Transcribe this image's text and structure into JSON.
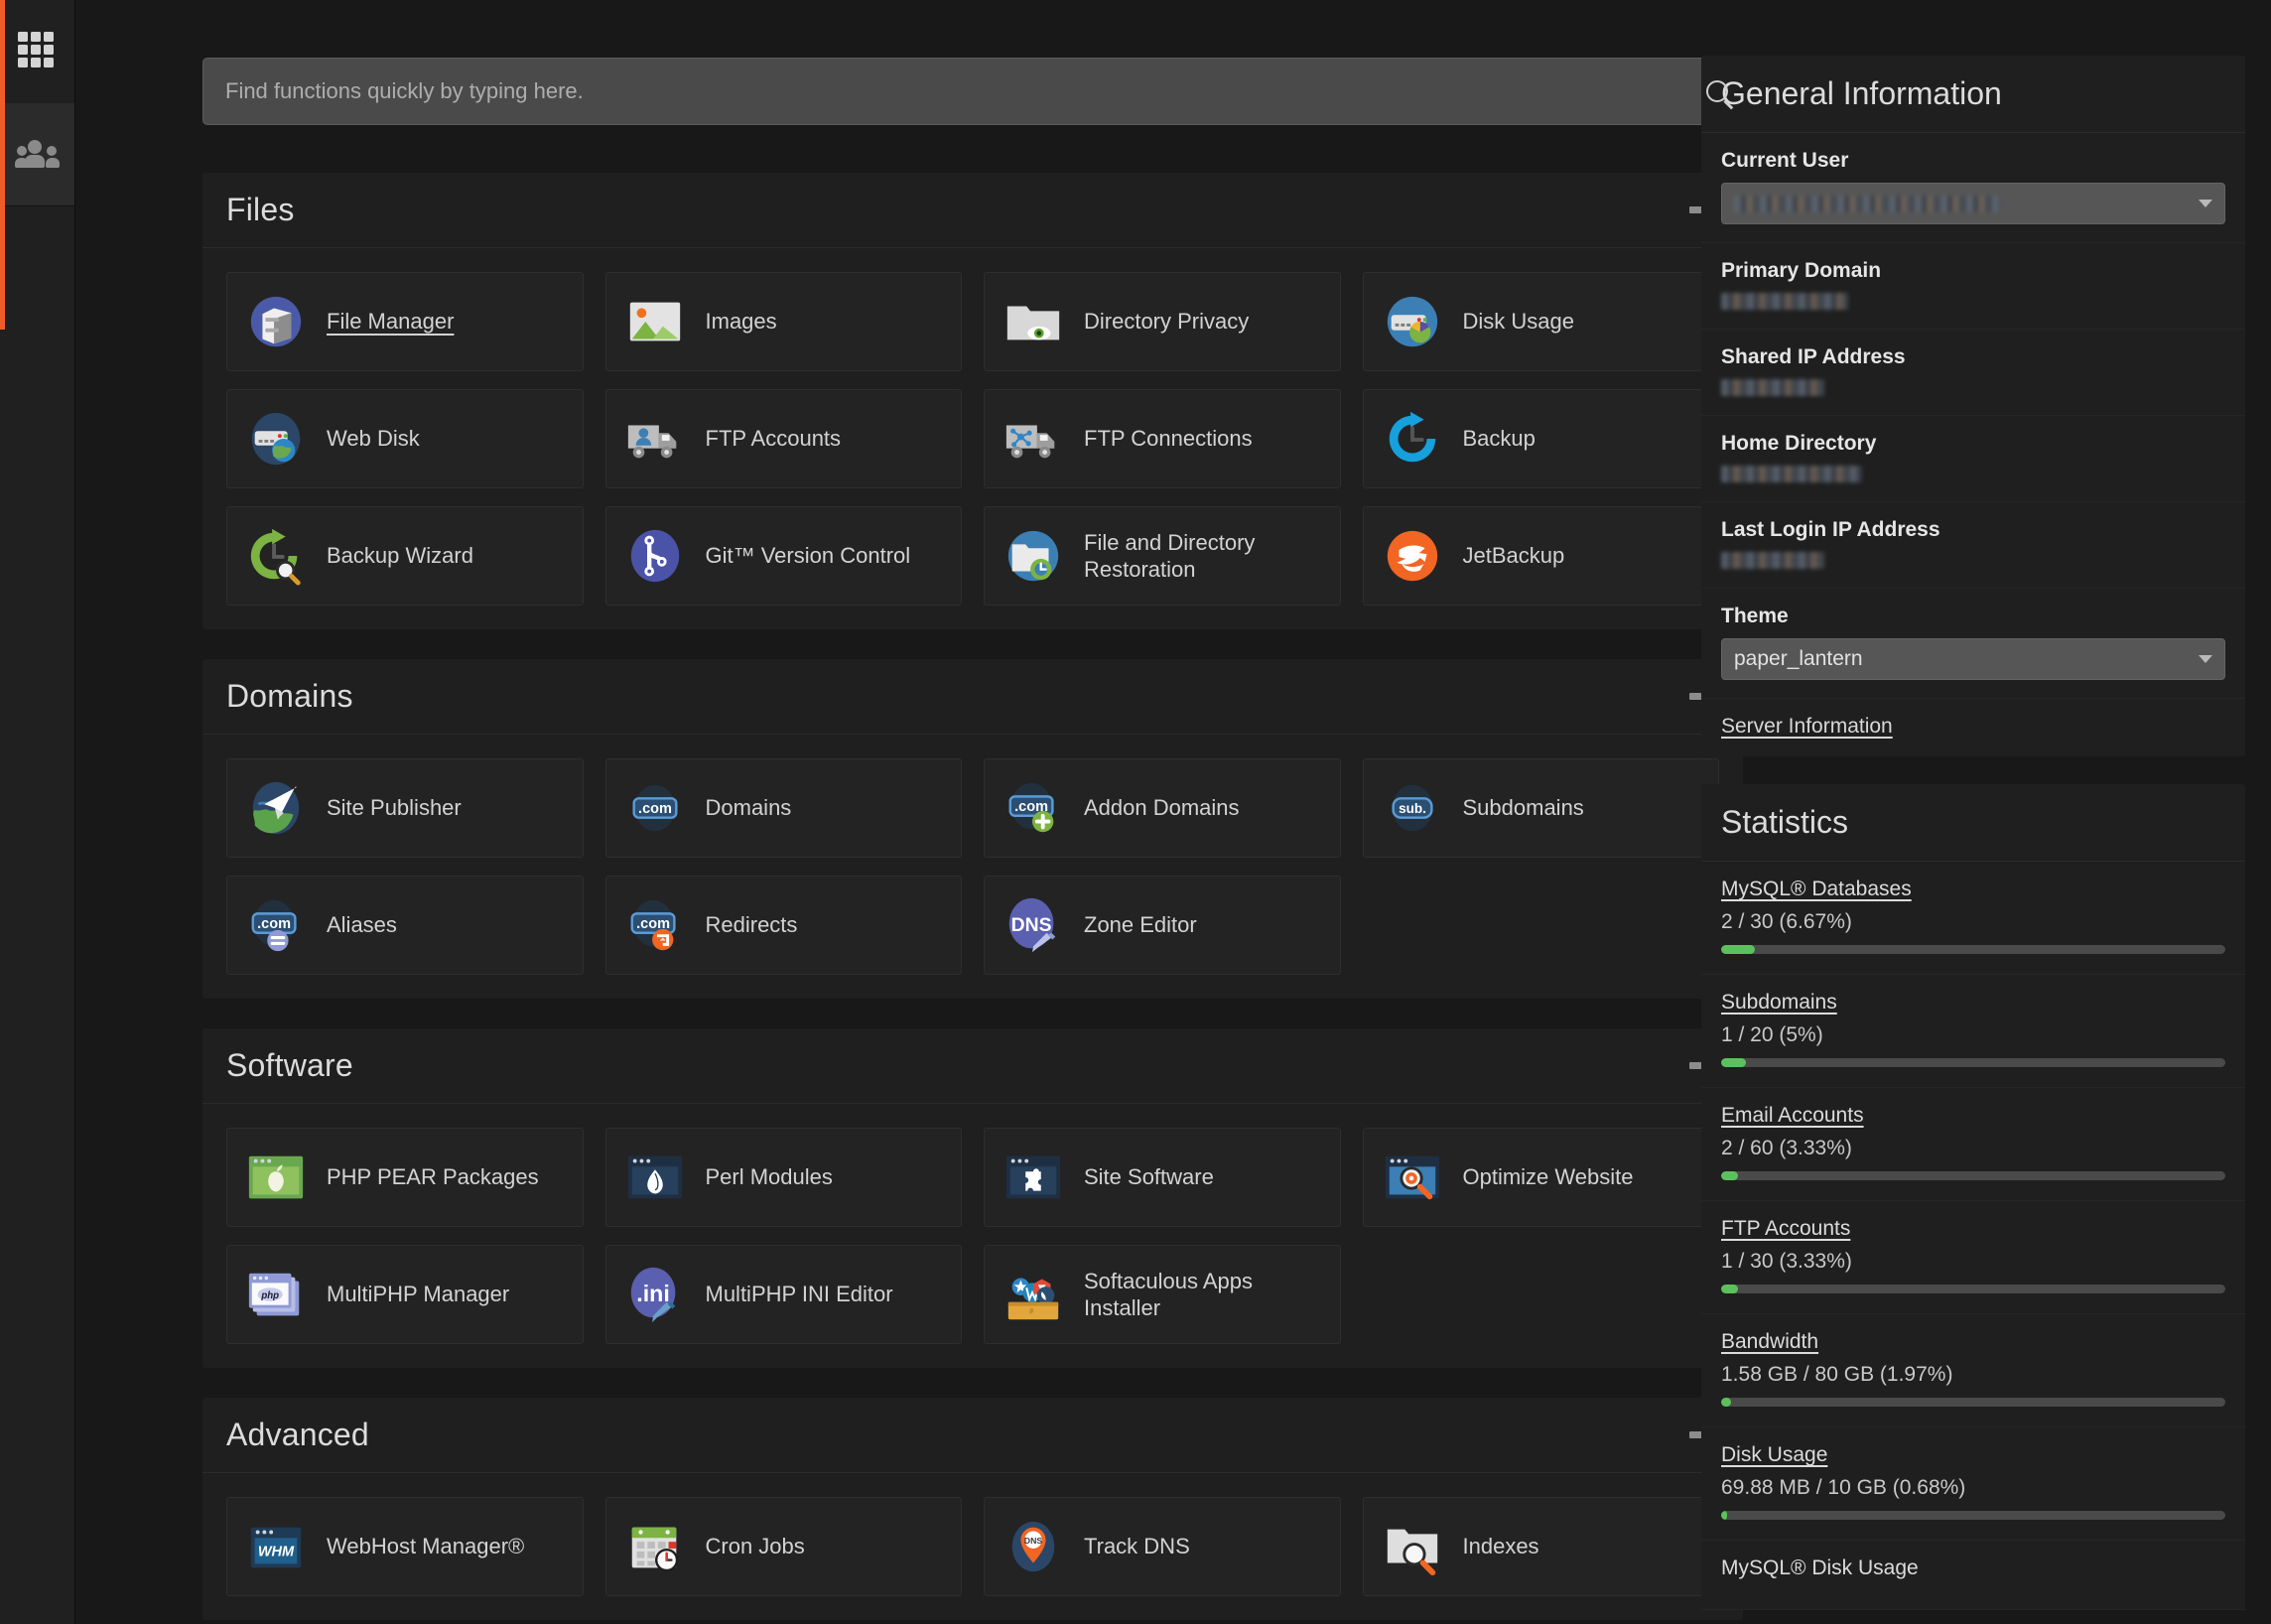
{
  "colors": {
    "accent": "#ef5c2a",
    "page_bg": "#181818",
    "card_bg": "#1f1f1f",
    "tile_bg": "#232323",
    "progress_fill": "#5cc15c",
    "progress_track": "#4a4a4a"
  },
  "rail": {
    "apps_icon": "grid-apps-icon",
    "users_icon": "users-icon"
  },
  "search": {
    "placeholder": "Find functions quickly by typing here.",
    "value": "",
    "icon": "search-icon"
  },
  "sections": [
    {
      "title": "Files",
      "collapse_label": "",
      "tiles": [
        {
          "label": "File Manager",
          "icon": "file-cabinet-icon",
          "hovered": true
        },
        {
          "label": "Images",
          "icon": "image-picture-icon",
          "hovered": false
        },
        {
          "label": "Directory Privacy",
          "icon": "folder-eye-icon",
          "hovered": false
        },
        {
          "label": "Disk Usage",
          "icon": "server-piechart-icon",
          "hovered": false
        },
        {
          "label": "Web Disk",
          "icon": "server-globe-icon",
          "hovered": false
        },
        {
          "label": "FTP Accounts",
          "icon": "truck-person-icon",
          "hovered": false
        },
        {
          "label": "FTP Connections",
          "icon": "truck-network-icon",
          "hovered": false
        },
        {
          "label": "Backup",
          "icon": "backup-clock-arrow-icon",
          "hovered": false
        },
        {
          "label": "Backup Wizard",
          "icon": "backup-wizard-icon",
          "hovered": false
        },
        {
          "label": "Git™ Version Control",
          "icon": "git-branch-icon",
          "hovered": false
        },
        {
          "label": "File and Directory Restoration",
          "icon": "folder-restore-icon",
          "hovered": false
        },
        {
          "label": "JetBackup",
          "icon": "jetbackup-icon",
          "hovered": false
        }
      ]
    },
    {
      "title": "Domains",
      "collapse_label": "",
      "tiles": [
        {
          "label": "Site Publisher",
          "icon": "paperplane-globe-icon",
          "hovered": false
        },
        {
          "label": "Domains",
          "icon": "dotcom-icon",
          "hovered": false
        },
        {
          "label": "Addon Domains",
          "icon": "dotcom-plus-icon",
          "hovered": false
        },
        {
          "label": "Subdomains",
          "icon": "sub-badge-icon",
          "hovered": false
        },
        {
          "label": "Aliases",
          "icon": "dotcom-equals-icon",
          "hovered": false
        },
        {
          "label": "Redirects",
          "icon": "dotcom-redirect-icon",
          "hovered": false
        },
        {
          "label": "Zone Editor",
          "icon": "dns-pencil-icon",
          "hovered": false
        }
      ]
    },
    {
      "title": "Software",
      "collapse_label": "",
      "tiles": [
        {
          "label": "PHP PEAR Packages",
          "icon": "pear-window-icon",
          "hovered": false
        },
        {
          "label": "Perl Modules",
          "icon": "perl-onion-icon",
          "hovered": false
        },
        {
          "label": "Site Software",
          "icon": "puzzle-window-icon",
          "hovered": false
        },
        {
          "label": "Optimize Website",
          "icon": "magnifier-gear-icon",
          "hovered": false
        },
        {
          "label": "MultiPHP Manager",
          "icon": "php-windows-icon",
          "hovered": false
        },
        {
          "label": "MultiPHP INI Editor",
          "icon": "ini-pencil-icon",
          "hovered": false
        },
        {
          "label": "Softaculous Apps Installer",
          "icon": "softaculous-box-icon",
          "hovered": false
        }
      ]
    },
    {
      "title": "Advanced",
      "collapse_label": "",
      "tiles": [
        {
          "label": "WebHost Manager®",
          "icon": "whm-window-icon",
          "hovered": false
        },
        {
          "label": "Cron Jobs",
          "icon": "calendar-clock-icon",
          "hovered": false
        },
        {
          "label": "Track DNS",
          "icon": "dns-pin-icon",
          "hovered": false
        },
        {
          "label": "Indexes",
          "icon": "folder-magnifier-icon",
          "hovered": false
        }
      ]
    }
  ],
  "general_information": {
    "title": "General Information",
    "rows": [
      {
        "label": "Current User",
        "type": "select",
        "value": "",
        "redacted": true,
        "redacted_width": 268
      },
      {
        "label": "Primary Domain",
        "type": "text",
        "value": "",
        "redacted": true,
        "redacted_width": 128
      },
      {
        "label": "Shared IP Address",
        "type": "text",
        "value": "",
        "redacted": true,
        "redacted_width": 104
      },
      {
        "label": "Home Directory",
        "type": "text",
        "value": "",
        "redacted": true,
        "redacted_width": 142
      },
      {
        "label": "Last Login IP Address",
        "type": "text",
        "value": "",
        "redacted": true,
        "redacted_width": 104
      },
      {
        "label": "Theme",
        "type": "select",
        "value": "paper_lantern",
        "redacted": false,
        "redacted_width": 0
      }
    ],
    "server_information_link": "Server Information"
  },
  "statistics": {
    "title": "Statistics",
    "items": [
      {
        "name": "MySQL® Databases",
        "value": "2 / 30  (6.67%)",
        "percent": 6.67,
        "is_link": true
      },
      {
        "name": "Subdomains",
        "value": "1 / 20  (5%)",
        "percent": 5,
        "is_link": true
      },
      {
        "name": "Email Accounts",
        "value": "2 / 60  (3.33%)",
        "percent": 3.33,
        "is_link": true
      },
      {
        "name": "FTP Accounts",
        "value": "1 / 30  (3.33%)",
        "percent": 3.33,
        "is_link": true
      },
      {
        "name": "Bandwidth",
        "value": "1.58 GB / 80 GB  (1.97%)",
        "percent": 1.97,
        "is_link": true
      },
      {
        "name": "Disk Usage",
        "value": "69.88 MB / 10 GB  (0.68%)",
        "percent": 0.68,
        "is_link": true
      },
      {
        "name": "MySQL® Disk Usage",
        "value": "",
        "percent": 0,
        "is_link": false
      }
    ]
  }
}
